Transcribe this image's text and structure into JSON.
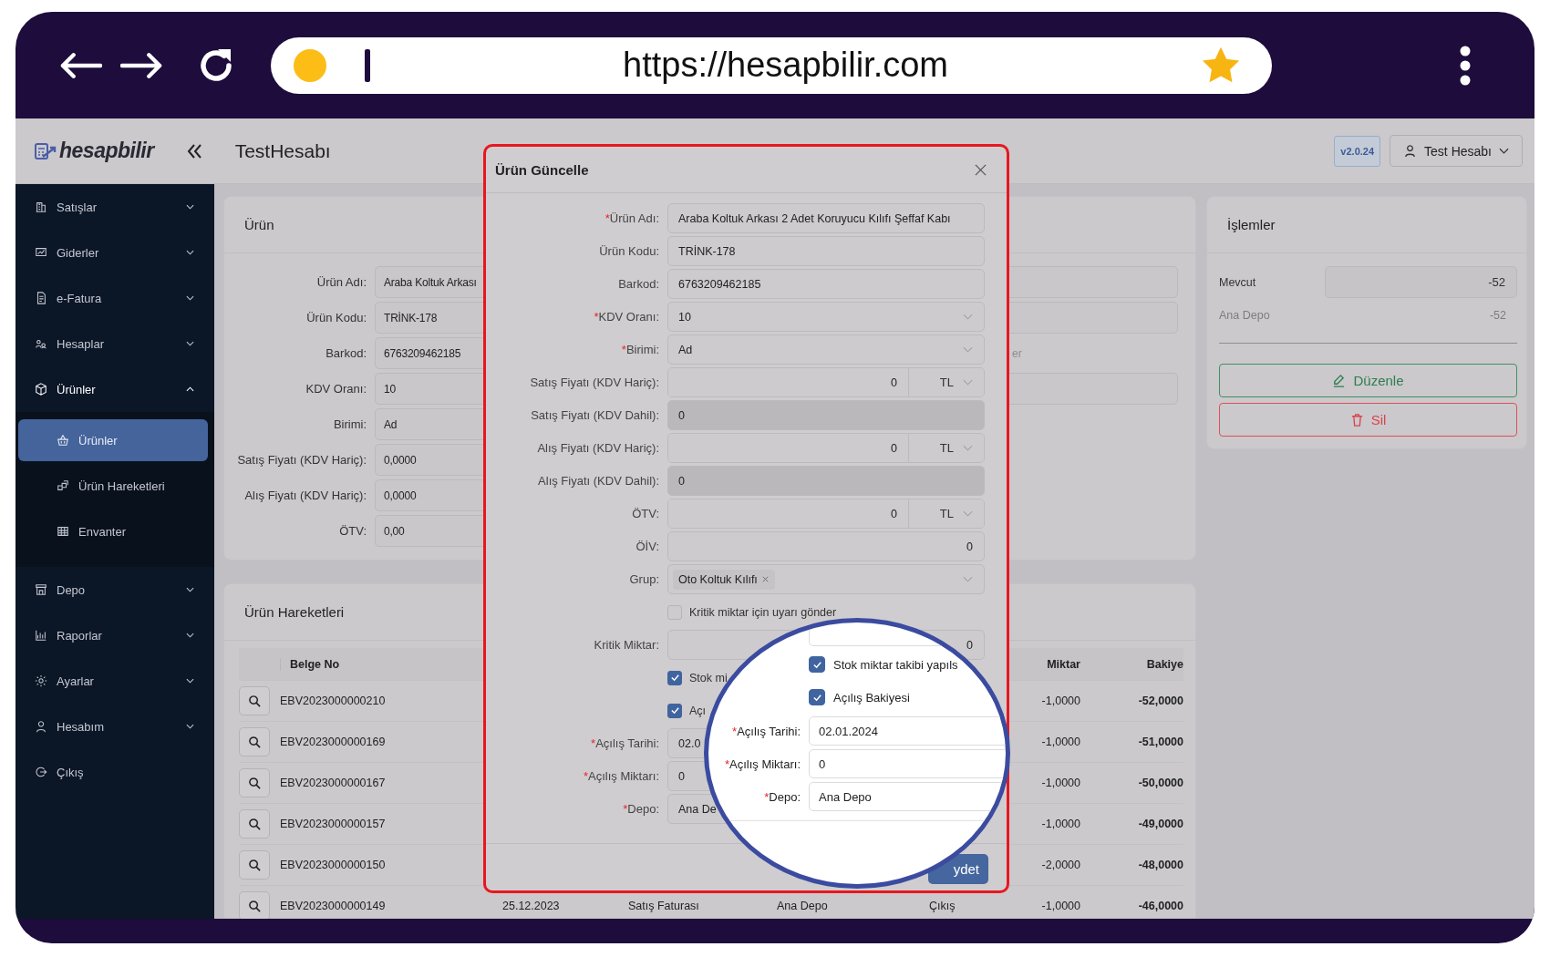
{
  "browser": {
    "url": "https://hesapbilir.com"
  },
  "header": {
    "logo": "hesapbilir",
    "title": "TestHesabı",
    "version": "v2.0.24",
    "user": "Test Hesabı"
  },
  "sidebar": {
    "items": [
      {
        "label": "Satışlar",
        "kind": "group",
        "expanded": false
      },
      {
        "label": "Giderler",
        "kind": "group",
        "expanded": false
      },
      {
        "label": "e-Fatura",
        "kind": "group",
        "expanded": false
      },
      {
        "label": "Hesaplar",
        "kind": "group",
        "expanded": false
      },
      {
        "label": "Ürünler",
        "kind": "group",
        "expanded": true,
        "children": [
          {
            "label": "Ürünler",
            "selected": true
          },
          {
            "label": "Ürün Hareketleri",
            "selected": false
          },
          {
            "label": "Envanter",
            "selected": false
          }
        ]
      },
      {
        "label": "Depo",
        "kind": "group",
        "expanded": false
      },
      {
        "label": "Raporlar",
        "kind": "group",
        "expanded": false
      },
      {
        "label": "Ayarlar",
        "kind": "group",
        "expanded": false
      },
      {
        "label": "Hesabım",
        "kind": "group",
        "expanded": false
      },
      {
        "label": "Çıkış",
        "kind": "link"
      }
    ]
  },
  "product_card": {
    "title": "Ürün",
    "fields": [
      {
        "label": "Ürün Adı:",
        "value": "Araba Koltuk Arkası"
      },
      {
        "label": "Ürün Kodu:",
        "value": "TRİNK-178"
      },
      {
        "label": "Barkod:",
        "value": "6763209462185"
      },
      {
        "label": "KDV Oranı:",
        "value": "10"
      },
      {
        "label": "Birimi:",
        "value": "Ad"
      },
      {
        "label": "Satış Fiyatı (KDV Hariç):",
        "value": "0,0000"
      },
      {
        "label": "Alış Fiyatı (KDV Hariç):",
        "value": "0,0000"
      },
      {
        "label": "ÖTV:",
        "value": "0,00"
      }
    ],
    "right_column": [
      {
        "kind": "input"
      },
      {
        "kind": "input"
      },
      {
        "kind": "hint",
        "text": "er"
      },
      {
        "kind": "input"
      }
    ]
  },
  "actions_card": {
    "title": "İşlemler",
    "stock": {
      "label": "Mevcut",
      "value": "-52"
    },
    "depots": [
      {
        "name": "Ana Depo",
        "value": "-52"
      }
    ],
    "buttons": [
      {
        "label": "Düzenle",
        "kind": "edit"
      },
      {
        "label": "Sil",
        "kind": "delete"
      }
    ]
  },
  "movements_card": {
    "title": "Ürün Hareketleri",
    "columns": {
      "belge_no": "Belge No",
      "miktar": "Miktar",
      "bakiye": "Bakiye"
    },
    "rows": [
      {
        "belge_no": "EBV2023000000210",
        "miktar": "-1,0000",
        "bakiye": "-52,0000"
      },
      {
        "belge_no": "EBV2023000000169",
        "miktar": "-1,0000",
        "bakiye": "-51,0000"
      },
      {
        "belge_no": "EBV2023000000167",
        "miktar": "-1,0000",
        "bakiye": "-50,0000"
      },
      {
        "belge_no": "EBV2023000000157",
        "miktar": "-1,0000",
        "bakiye": "-49,0000"
      },
      {
        "belge_no": "EBV2023000000150",
        "miktar": "-2,0000",
        "bakiye": "-48,0000"
      },
      {
        "belge_no": "EBV2023000000149",
        "column_3": "25.12.2023",
        "column_4": "Satış Faturası",
        "column_5": "Ana Depo",
        "column_6": "Çıkış",
        "miktar": "-1,0000",
        "bakiye": "-46,0000"
      }
    ]
  },
  "modal": {
    "title": "Ürün Güncelle",
    "fields": [
      {
        "kind": "text",
        "required_mark": "*",
        "label": "Ürün Adı:",
        "value": "Araba Koltuk Arkası 2 Adet Koruyucu Kılıfı Şeffaf Kabı",
        "disabled": false
      },
      {
        "kind": "text",
        "label": "Ürün Kodu:",
        "value": "TRİNK-178",
        "disabled": false
      },
      {
        "kind": "text",
        "label": "Barkod:",
        "value": "6763209462185",
        "disabled": false
      },
      {
        "kind": "select",
        "required_mark": "*",
        "label": "KDV Oranı:",
        "value": "10",
        "disabled": false
      },
      {
        "kind": "select",
        "required_mark": "*",
        "label": "Birimi:",
        "value": "Ad",
        "disabled": false
      },
      {
        "kind": "money",
        "label": "Satış Fiyatı (KDV Hariç):",
        "value": "0",
        "currency": "TL",
        "disabled": false
      },
      {
        "kind": "text",
        "label": "Satış Fiyatı (KDV Dahil):",
        "value": "0",
        "disabled": true
      },
      {
        "kind": "money",
        "label": "Alış Fiyatı (KDV Hariç):",
        "value": "0",
        "currency": "TL",
        "disabled": false
      },
      {
        "kind": "text",
        "label": "Alış Fiyatı (KDV Dahil):",
        "value": "0",
        "disabled": true
      },
      {
        "kind": "money",
        "label": "ÖTV:",
        "value": "0",
        "currency": "TL",
        "disabled": false
      },
      {
        "kind": "number",
        "label": "ÖİV:",
        "value": "0",
        "disabled": false
      },
      {
        "kind": "tag",
        "label": "Grup:",
        "tag": "Oto Koltuk Kılıfı",
        "disabled": false
      },
      {
        "kind": "checkbox",
        "label": "Kritik miktar için uyarı gönder",
        "checked": false
      },
      {
        "kind": "number",
        "label": "Kritik Miktar:",
        "value": "0",
        "disabled": false
      },
      {
        "kind": "checkbox",
        "label": "Stok mi",
        "checked": true
      },
      {
        "kind": "checkbox",
        "label": "Açı",
        "checked": true
      },
      {
        "kind": "text",
        "required_mark": "*",
        "label": "Açılış Tarihi:",
        "value": "02.0",
        "disabled": false
      },
      {
        "kind": "text",
        "required_mark": "*",
        "label": "Açılış Miktarı:",
        "value": "0",
        "disabled": false
      },
      {
        "kind": "text",
        "required_mark": "*",
        "label": "Depo:",
        "value": "Ana De",
        "disabled": false
      }
    ],
    "save_button": "ydet"
  },
  "magnifier": {
    "checkboxes": [
      {
        "label": "Stok miktar takibi yapıls",
        "checked": true
      },
      {
        "label": "Açılış Bakiyesi",
        "checked": true
      }
    ],
    "fields": [
      {
        "required_mark": "*",
        "label": "Açılış Tarihi:",
        "value": "02.01.2024"
      },
      {
        "required_mark": "*",
        "label": "Açılış Miktarı:",
        "value": "0"
      },
      {
        "required_mark": "*",
        "label": "Depo:",
        "value": "Ana Depo"
      }
    ]
  }
}
